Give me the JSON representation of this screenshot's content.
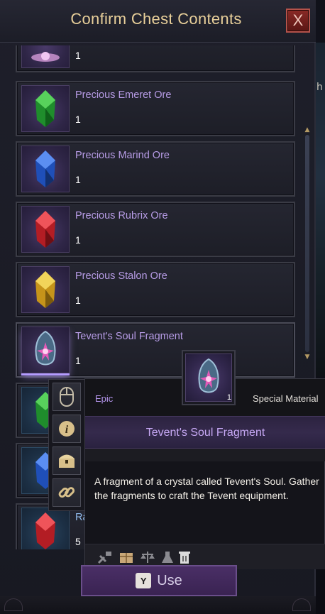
{
  "window": {
    "title": "Confirm Chest Contents",
    "close_label": "X"
  },
  "background_text": "h",
  "items": [
    {
      "name": "",
      "qty": "1",
      "icon": "pink-crystal-icon"
    },
    {
      "name": "Precious Emeret Ore",
      "qty": "1",
      "icon": "green-gem-icon"
    },
    {
      "name": "Precious Marind Ore",
      "qty": "1",
      "icon": "blue-gem-icon"
    },
    {
      "name": "Precious Rubrix Ore",
      "qty": "1",
      "icon": "red-gem-icon"
    },
    {
      "name": "Precious Stalon Ore",
      "qty": "1",
      "icon": "yellow-gem-icon"
    },
    {
      "name": "Tevent's Soul Fragment",
      "qty": "1",
      "icon": "soul-fragment-icon",
      "selected": true
    },
    {
      "name": "",
      "qty": "",
      "icon": "green-gem-icon"
    },
    {
      "name": "",
      "qty": "",
      "icon": "blue-gem-icon"
    },
    {
      "name": "Ra",
      "qty": "5",
      "icon": "red-gem-icon"
    }
  ],
  "side_toolbar": [
    "mouse-icon",
    "info-icon",
    "chest-icon",
    "link-icon"
  ],
  "tooltip": {
    "grade": "Epic",
    "type": "Special Material",
    "name": "Tevent's Soul Fragment",
    "description": "A fragment of a crystal called Tevent's Soul. Gather the fragments to craft the Tevent equipment.",
    "icon_qty": "1",
    "footer_icons": [
      "dismantle-icon",
      "storage-icon",
      "market-icon",
      "alchemy-icon",
      "trash-icon"
    ]
  },
  "use_button": {
    "key": "Y",
    "label": "Use"
  },
  "colors": {
    "title": "#e8cf9a",
    "epic": "#b495ec",
    "accent_button": "#4a2f66"
  }
}
